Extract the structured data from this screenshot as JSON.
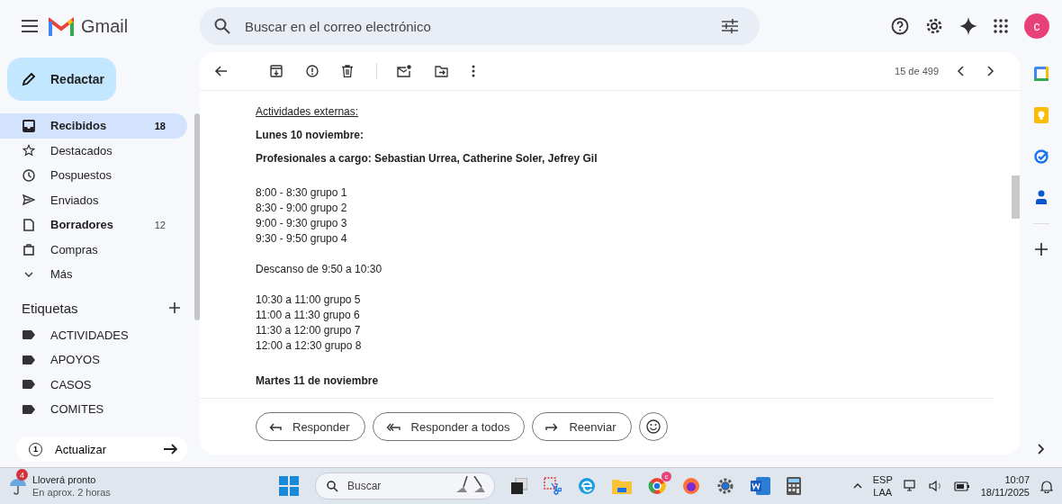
{
  "header": {
    "app_name": "Gmail",
    "search_placeholder": "Buscar en el correo electrónico",
    "avatar_letter": "c"
  },
  "compose": {
    "label": "Redactar"
  },
  "nav": [
    {
      "kind": "inbox",
      "label": "Recibidos",
      "count": "18",
      "bold": true,
      "selected": true
    },
    {
      "kind": "star",
      "label": "Destacados",
      "bold": false,
      "selected": false
    },
    {
      "kind": "clock",
      "label": "Pospuestos",
      "bold": false,
      "selected": false
    },
    {
      "kind": "send",
      "label": "Enviados",
      "bold": false,
      "selected": false
    },
    {
      "kind": "file",
      "label": "Borradores",
      "count": "12",
      "bold": true,
      "selected": false
    },
    {
      "kind": "bag",
      "label": "Compras",
      "bold": false,
      "selected": false
    },
    {
      "kind": "more",
      "label": "Más",
      "bold": false,
      "selected": false
    }
  ],
  "labels": {
    "title": "Etiquetas",
    "items": [
      "ACTIVIDADES",
      "APOYOS",
      "CASOS",
      "COMITES"
    ]
  },
  "update": {
    "badge": "1",
    "label": "Actualizar"
  },
  "toolbar": {
    "pager": "15 de 499"
  },
  "body": [
    {
      "kind": "link",
      "lines": [
        "Actividades externas:"
      ]
    },
    {
      "kind": "bold",
      "lines": [
        "Lunes 10 noviembre:"
      ]
    },
    {
      "kind": "bold",
      "lines": [
        "Profesionales a cargo:  Sebastian Urrea, Catherine Soler, Jefrey Gil"
      ]
    },
    {
      "kind": "plain",
      "lines": [
        "8:00 - 8:30 grupo 1",
        "8:30 - 9:00 grupo 2",
        "9:00 - 9:30 grupo 3",
        "9:30 - 9:50 grupo 4"
      ]
    },
    {
      "kind": "plain",
      "lines": [
        "Descanso de 9:50 a 10:30"
      ]
    },
    {
      "kind": "plain",
      "lines": [
        "10:30 a 11:00 grupo 5",
        "11:00 a 11:30 grupo 6",
        "11:30 a 12:00 grupo 7",
        "12:00 a 12:30 grupo 8"
      ]
    },
    {
      "kind": "bold",
      "lines": [
        "Martes 11 de noviembre"
      ]
    }
  ],
  "reply_buttons": [
    {
      "kind": "reply",
      "label": "Responder"
    },
    {
      "kind": "reply_all",
      "label": "Responder a todos"
    },
    {
      "kind": "forward",
      "label": "Reenviar"
    }
  ],
  "taskbar": {
    "weather_badge": "4",
    "weather_title": "Lloverá pronto",
    "weather_sub": "En aprox. 2 horas",
    "search_placeholder": "Buscar",
    "chrome_badge": "c",
    "lang_top": "ESP",
    "lang_bottom": "LAA",
    "time": "10:07",
    "date": "18/11/2025"
  }
}
